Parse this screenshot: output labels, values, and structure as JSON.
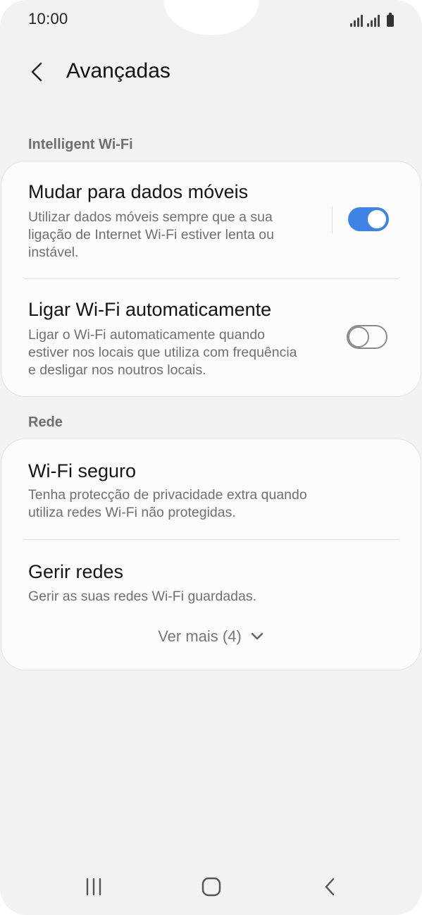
{
  "status_bar": {
    "time": "10:00"
  },
  "header": {
    "title": "Avançadas"
  },
  "sections": {
    "intelligent_wifi": {
      "label": "Intelligent Wi-Fi",
      "items": [
        {
          "title": "Mudar para dados móveis",
          "description_lines": [
            "Utilizar dados móveis sempre que a sua",
            "ligação de Internet Wi-Fi estiver lenta ou",
            "instável."
          ],
          "toggle": "on"
        },
        {
          "title": "Ligar Wi-Fi automaticamente",
          "description_lines": [
            "Ligar o Wi-Fi automaticamente quando",
            "estiver nos locais que utiliza com frequência",
            "e desligar nos noutros locais."
          ],
          "toggle": "off"
        }
      ]
    },
    "rede": {
      "label": "Rede",
      "items": [
        {
          "title": "Wi-Fi seguro",
          "description_lines": [
            "Tenha protecção de privacidade extra quando",
            "utiliza redes Wi-Fi não protegidas."
          ]
        },
        {
          "title": "Gerir redes",
          "description_lines": [
            "Gerir as suas redes Wi-Fi guardadas."
          ]
        }
      ],
      "see_more": "Ver mais (4)"
    }
  },
  "colors": {
    "accent": "#3e84e6",
    "background": "#f2f2f2",
    "card": "#fcfcfc"
  },
  "icons": {
    "back": "chevron-left-icon",
    "see_more": "chevron-down-icon",
    "nav_recents": "recents-icon",
    "nav_home": "home-icon",
    "nav_back": "back-icon"
  }
}
